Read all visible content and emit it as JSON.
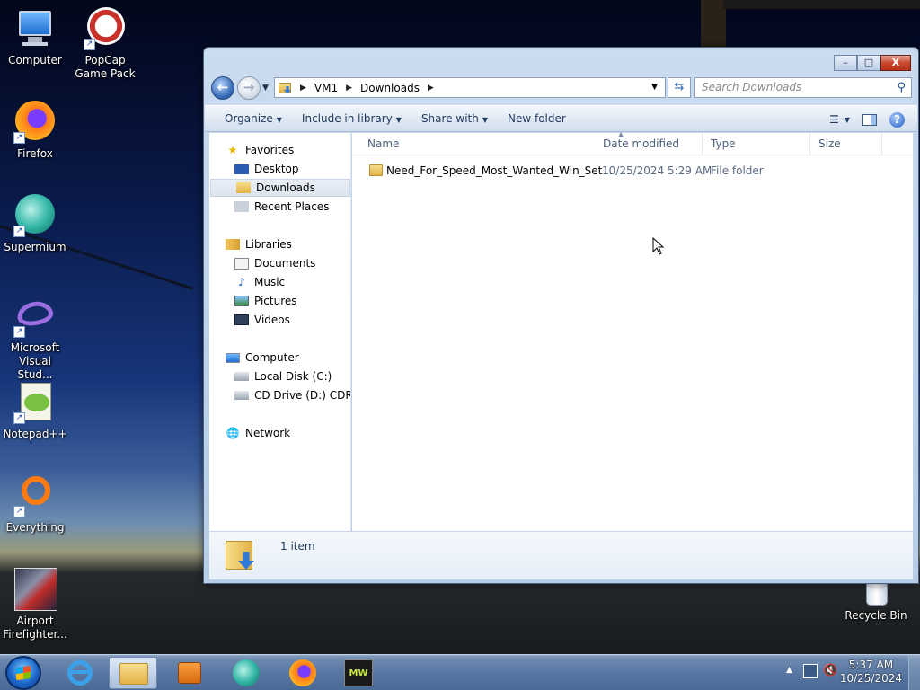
{
  "desktop": {
    "icons": [
      {
        "label": "Computer",
        "icon": "computer-icon"
      },
      {
        "label": "PopCap Game Pack",
        "icon": "popcap-icon"
      },
      {
        "label": "Firefox",
        "icon": "firefox-icon"
      },
      {
        "label": "Supermium",
        "icon": "supermium-icon"
      },
      {
        "label": "Microsoft Visual Stud...",
        "icon": "visual-studio-icon"
      },
      {
        "label": "Notepad++",
        "icon": "notepadpp-icon"
      },
      {
        "label": "Everything",
        "icon": "everything-icon"
      },
      {
        "label": "Airport Firefighter...",
        "icon": "airport-firefighter-icon"
      },
      {
        "label": "Recycle Bin",
        "icon": "recycle-bin-icon"
      }
    ]
  },
  "window": {
    "buttons": {
      "minimize": "–",
      "maximize": "□",
      "close": "X"
    },
    "address": {
      "crumbs": [
        "VM1",
        "Downloads"
      ]
    },
    "search": {
      "placeholder": "Search Downloads"
    },
    "toolbar": {
      "organize": "Organize",
      "include_in_library": "Include in library",
      "share_with": "Share with",
      "new_folder": "New folder",
      "help": "?"
    },
    "nav": {
      "favorites": {
        "label": "Favorites",
        "items": [
          "Desktop",
          "Downloads",
          "Recent Places"
        ]
      },
      "libraries": {
        "label": "Libraries",
        "items": [
          "Documents",
          "Music",
          "Pictures",
          "Videos"
        ]
      },
      "computer": {
        "label": "Computer",
        "items": [
          "Local Disk (C:)",
          "CD Drive (D:) CDROM"
        ]
      },
      "network": {
        "label": "Network"
      },
      "selected": "Downloads"
    },
    "columns": {
      "name": "Name",
      "date": "Date modified",
      "type": "Type",
      "size": "Size"
    },
    "files": [
      {
        "name": "Need_For_Speed_Most_Wanted_Win_Set...",
        "date": "10/25/2024 5:29 AM",
        "type": "File folder",
        "size": ""
      }
    ],
    "details": {
      "count": "1 item"
    }
  },
  "taskbar": {
    "items": [
      "start",
      "internet-explorer",
      "windows-explorer",
      "media-player",
      "supermium",
      "firefox",
      "nfs-most-wanted"
    ],
    "active": "windows-explorer",
    "clock": {
      "time": "5:37 AM",
      "date": "10/25/2024"
    }
  },
  "colors": {
    "accent": "#1e395b",
    "selection": "#dde5f0",
    "taskbar": "#5877a2"
  }
}
